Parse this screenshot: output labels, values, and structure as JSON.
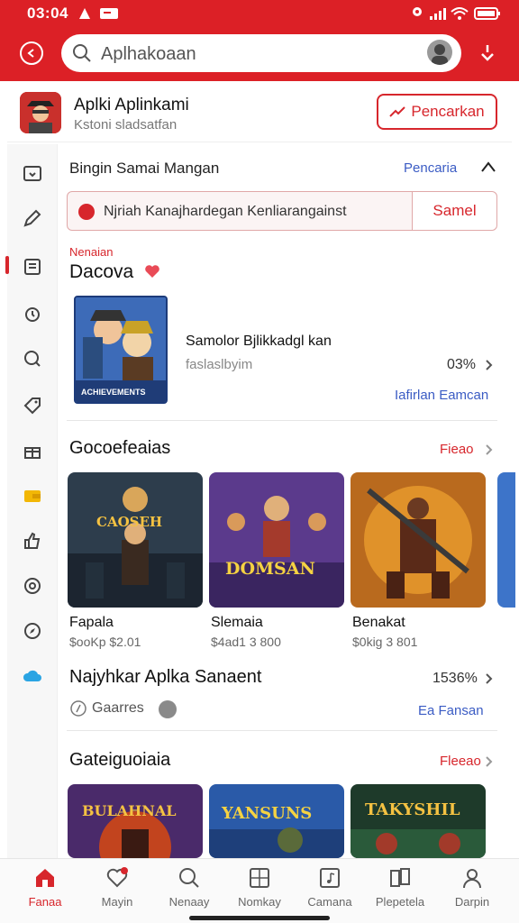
{
  "status_bar": {
    "time": "03:04"
  },
  "search": {
    "placeholder": "Aplhakoaan"
  },
  "header": {
    "title": "Aplki Aplinkami",
    "subtitle": "Kstoni sladsatfan",
    "button_label": "Pencarkan"
  },
  "section_top": {
    "title": "Bingin Samai Mangan",
    "link": "Pencaria"
  },
  "alert": {
    "text": "Njriah Kanajhardegan Kenliarangainst",
    "button": "Samel"
  },
  "featured": {
    "kicker": "Nenaian",
    "title": "Dacova",
    "app_name": "Samolor Bjlikkadgl kan",
    "app_sub": "faslaslbyim",
    "percent": "03%",
    "link": "Iafirlan Eamcan",
    "thumb_text": "ACHIEVEMENTS"
  },
  "games_section": {
    "title": "Gocoefeaias",
    "link": "Fieao",
    "items": [
      {
        "title": "Fapala",
        "meta": "$ooKp $2.01",
        "art": "CAOSEH"
      },
      {
        "title": "Slemaia",
        "meta": "$4ad1 3 800",
        "art": "DOMSAN"
      },
      {
        "title": "Benakat",
        "meta": "$0kig 3 801",
        "art": ""
      }
    ]
  },
  "popular": {
    "title": "Najyhkar Aplka Sanaent",
    "percent": "1536%",
    "chip": "Gaarres",
    "link": "Ea Fansan"
  },
  "categories": {
    "title": "Gateiguoiaia",
    "link": "Fleeao",
    "items": [
      {
        "art": "BULAHNAL"
      },
      {
        "art": "YANSUNS"
      },
      {
        "art": "TAKYSHIL"
      }
    ]
  },
  "bottom_nav": [
    {
      "label": "Fanaa",
      "icon": "home-icon"
    },
    {
      "label": "Mayin",
      "icon": "heart-icon"
    },
    {
      "label": "Nenaay",
      "icon": "search-icon"
    },
    {
      "label": "Nomkay",
      "icon": "grid-icon"
    },
    {
      "label": "Camana",
      "icon": "music-icon"
    },
    {
      "label": "Plepetela",
      "icon": "library-icon"
    },
    {
      "label": "Darpin",
      "icon": "profile-icon"
    }
  ],
  "colors": {
    "brand_red": "#dc2026",
    "link_blue": "#3b5cc4"
  }
}
